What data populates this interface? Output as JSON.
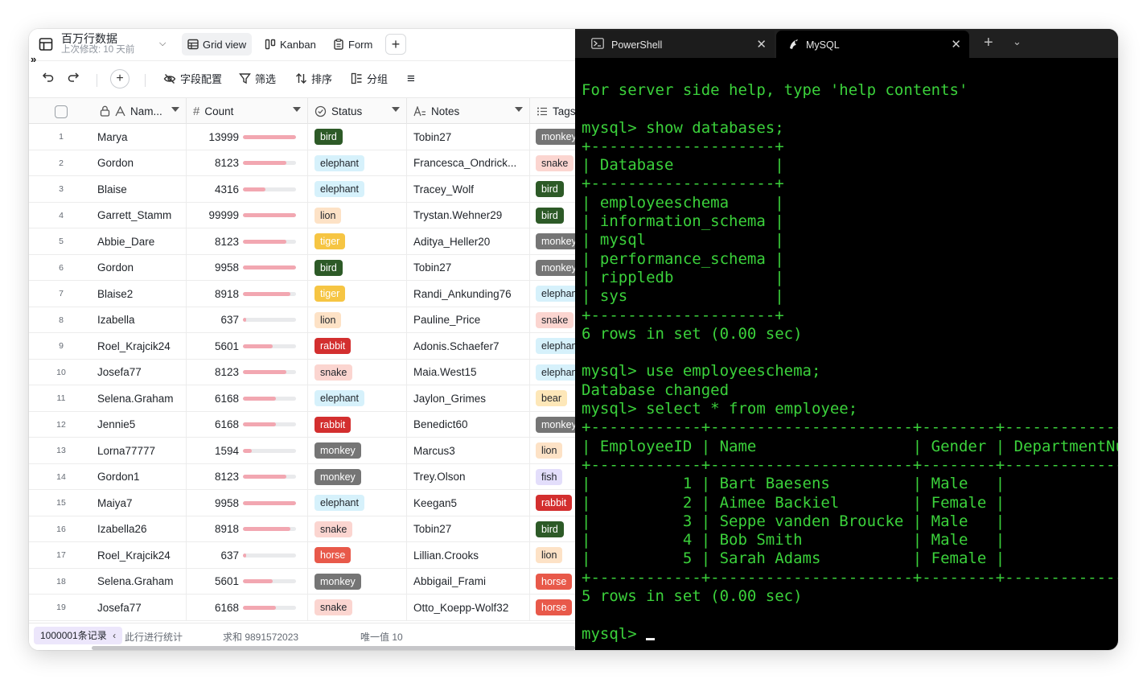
{
  "app": {
    "title": "百万行数据",
    "subtitle": "上次修改:  10 天前",
    "views": [
      {
        "label": "Grid view"
      },
      {
        "label": "Kanban"
      },
      {
        "label": "Form"
      }
    ],
    "toolbar": {
      "field_config": "字段配置",
      "filter": "筛选",
      "sort": "排序",
      "group": "分组"
    },
    "columns": {
      "name": "Nam...",
      "count": "Count",
      "status": "Status",
      "notes": "Notes",
      "tags": "Tags"
    },
    "rows": [
      {
        "n": "1",
        "name": "Marya",
        "count": "13999",
        "pct": 1.0,
        "status": "bird",
        "notes": "Tobin27",
        "tag": "monkey"
      },
      {
        "n": "2",
        "name": "Gordon",
        "count": "8123",
        "pct": 0.82,
        "status": "elephant",
        "notes": "Francesca_Ondrick...",
        "tag": "snake"
      },
      {
        "n": "3",
        "name": "Blaise",
        "count": "4316",
        "pct": 0.42,
        "status": "elephant",
        "notes": "Tracey_Wolf",
        "tag": "bird"
      },
      {
        "n": "4",
        "name": "Garrett_Stamm",
        "count": "99999",
        "pct": 1.0,
        "status": "lion",
        "notes": "Trystan.Wehner29",
        "tag": "bird"
      },
      {
        "n": "5",
        "name": "Abbie_Dare",
        "count": "8123",
        "pct": 0.82,
        "status": "tiger",
        "notes": "Aditya_Heller20",
        "tag": "monkey"
      },
      {
        "n": "6",
        "name": "Gordon",
        "count": "9958",
        "pct": 1.0,
        "status": "bird",
        "notes": "Tobin27",
        "tag": "monkey"
      },
      {
        "n": "7",
        "name": "Blaise2",
        "count": "8918",
        "pct": 0.9,
        "status": "tiger",
        "notes": "Randi_Ankunding76",
        "tag": "elephant"
      },
      {
        "n": "8",
        "name": "Izabella",
        "count": "637",
        "pct": 0.06,
        "status": "lion",
        "notes": "Pauline_Price",
        "tag": "snake"
      },
      {
        "n": "9",
        "name": "Roel_Krajcik24",
        "count": "5601",
        "pct": 0.56,
        "status": "rabbit",
        "notes": "Adonis.Schaefer7",
        "tag": "elephant"
      },
      {
        "n": "10",
        "name": "Josefa77",
        "count": "8123",
        "pct": 0.82,
        "status": "snake",
        "notes": "Maia.West15",
        "tag": "elephant"
      },
      {
        "n": "11",
        "name": "Selena.Graham",
        "count": "6168",
        "pct": 0.62,
        "status": "elephant",
        "notes": "Jaylon_Grimes",
        "tag": "bear"
      },
      {
        "n": "12",
        "name": "Jennie5",
        "count": "6168",
        "pct": 0.62,
        "status": "rabbit",
        "notes": "Benedict60",
        "tag": "monkey"
      },
      {
        "n": "13",
        "name": "Lorna77777",
        "count": "1594",
        "pct": 0.16,
        "status": "monkey",
        "notes": "Marcus3",
        "tag": "lion"
      },
      {
        "n": "14",
        "name": "Gordon1",
        "count": "8123",
        "pct": 0.82,
        "status": "monkey",
        "notes": "Trey.Olson",
        "tag": "fish"
      },
      {
        "n": "15",
        "name": "Maiya7",
        "count": "9958",
        "pct": 1.0,
        "status": "elephant",
        "notes": "Keegan5",
        "tag": "rabbit"
      },
      {
        "n": "16",
        "name": "Izabella26",
        "count": "8918",
        "pct": 0.9,
        "status": "snake",
        "notes": "Tobin27",
        "tag": "bird"
      },
      {
        "n": "17",
        "name": "Roel_Krajcik24",
        "count": "637",
        "pct": 0.06,
        "status": "horse",
        "notes": "Lillian.Crooks",
        "tag": "lion"
      },
      {
        "n": "18",
        "name": "Selena.Graham",
        "count": "5601",
        "pct": 0.56,
        "status": "monkey",
        "notes": "Abbigail_Frami",
        "tag": "horse"
      },
      {
        "n": "19",
        "name": "Josefa77",
        "count": "6168",
        "pct": 0.62,
        "status": "snake",
        "notes": "Otto_Koepp-Wolf32",
        "tag": "horse"
      }
    ],
    "tag_colors": {
      "bird": {
        "bg": "#2d5a27",
        "fg": "#ffffff"
      },
      "elephant": {
        "bg": "#d6f1fb",
        "fg": "#1f2329"
      },
      "lion": {
        "bg": "#fde2c6",
        "fg": "#1f2329"
      },
      "tiger": {
        "bg": "#f6c543",
        "fg": "#ffffff"
      },
      "rabbit": {
        "bg": "#d32f2f",
        "fg": "#ffffff"
      },
      "snake": {
        "bg": "#fbd5d0",
        "fg": "#1f2329"
      },
      "monkey": {
        "bg": "#757575",
        "fg": "#ffffff"
      },
      "horse": {
        "bg": "#e8594a",
        "fg": "#ffffff"
      },
      "bear": {
        "bg": "#fde7b8",
        "fg": "#1f2329"
      },
      "fish": {
        "bg": "#e3defb",
        "fg": "#1f2329"
      }
    },
    "footer": {
      "records": "1000001条记录",
      "stat_hint": "此行进行统计",
      "sum": "求和 9891572023",
      "unique": "唯一值 10"
    }
  },
  "terminal": {
    "tabs": [
      {
        "label": "PowerShell"
      },
      {
        "label": "MySQL"
      }
    ],
    "lines": [
      "For server side help, type 'help contents'",
      "",
      "mysql> show databases;",
      "+--------------------+",
      "| Database           |",
      "+--------------------+",
      "| employeeschema     |",
      "| information_schema |",
      "| mysql              |",
      "| performance_schema |",
      "| rippledb           |",
      "| sys                |",
      "+--------------------+",
      "6 rows in set (0.00 sec)",
      "",
      "mysql> use employeeschema;",
      "Database changed",
      "mysql> select * from employee;",
      "+------------+----------------------+--------+-----------------",
      "| EmployeeID | Name                 | Gender | DepartmentNumber",
      "+------------+----------------------+--------+-----------------",
      "|          1 | Bart Baesens         | Male   |",
      "|          2 | Aimee Backiel        | Female |",
      "|          3 | Seppe vanden Broucke | Male   |",
      "|          4 | Bob Smith            | Male   |",
      "|          5 | Sarah Adams          | Female |",
      "+------------+----------------------+--------+-----------------",
      "5 rows in set (0.00 sec)",
      ""
    ],
    "prompt": "mysql> "
  }
}
